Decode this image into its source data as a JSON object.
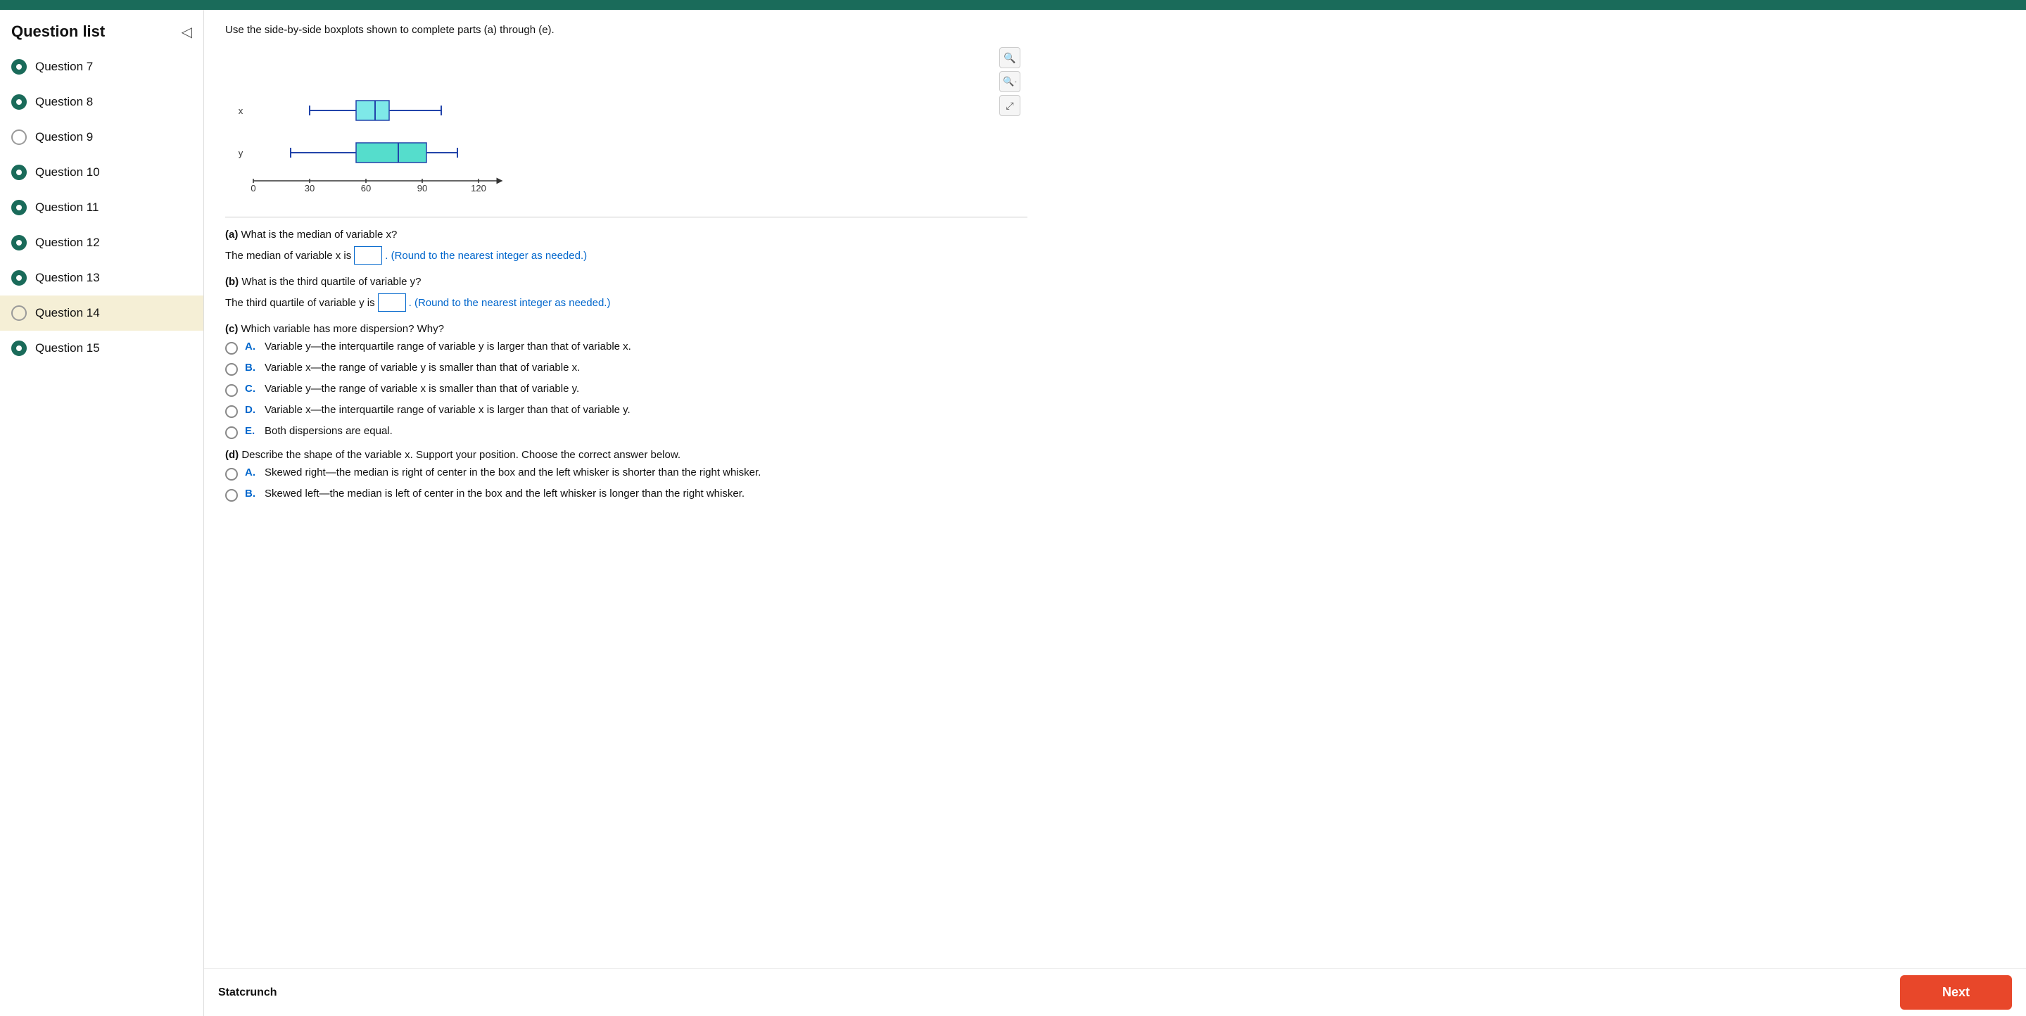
{
  "topBar": {},
  "sidebar": {
    "title": "Question list",
    "collapseLabel": "◁",
    "items": [
      {
        "id": 7,
        "label": "Question 7",
        "filled": true,
        "active": false
      },
      {
        "id": 8,
        "label": "Question 8",
        "filled": true,
        "active": false
      },
      {
        "id": 9,
        "label": "Question 9",
        "filled": false,
        "active": false
      },
      {
        "id": 10,
        "label": "Question 10",
        "filled": true,
        "active": false
      },
      {
        "id": 11,
        "label": "Question 11",
        "filled": true,
        "active": false
      },
      {
        "id": 12,
        "label": "Question 12",
        "filled": true,
        "active": false
      },
      {
        "id": 13,
        "label": "Question 13",
        "filled": true,
        "active": false
      },
      {
        "id": 14,
        "label": "Question 14",
        "filled": false,
        "active": true
      },
      {
        "id": 15,
        "label": "Question 15",
        "filled": true,
        "active": false
      }
    ],
    "footerLabel": "Statcrunch"
  },
  "content": {
    "instruction": "Use the side-by-side boxplots shown to complete parts (a) through (e).",
    "partA": {
      "question": "(a) What is the median of variable x?",
      "answerPrefix": "The median of variable x is",
      "answerSuffix": ". (Round to the nearest integer as needed.)"
    },
    "partB": {
      "question": "(b) What is the third quartile of variable y?",
      "answerPrefix": "The third quartile of variable y is",
      "answerSuffix": ". (Round to the nearest integer as needed.)"
    },
    "partC": {
      "question": "(c) Which variable has more dispersion? Why?",
      "options": [
        {
          "letter": "A.",
          "text": "Variable y—the interquartile range of variable y is larger than that of variable x."
        },
        {
          "letter": "B.",
          "text": "Variable x—the range of variable y is smaller than that of variable x."
        },
        {
          "letter": "C.",
          "text": "Variable y—the range of variable x is smaller than that of variable y."
        },
        {
          "letter": "D.",
          "text": "Variable x—the interquartile range of variable x is larger than that of variable y."
        },
        {
          "letter": "E.",
          "text": "Both dispersions are equal."
        }
      ]
    },
    "partD": {
      "question": "(d) Describe the shape of the variable x. Support your position. Choose the correct answer below.",
      "options": [
        {
          "letter": "A.",
          "text": "Skewed right—the median is right of center in the box and the left whisker is shorter than the right whisker."
        },
        {
          "letter": "B.",
          "text": "Skewed left—the median is left of center in the box and the left whisker is longer than the right whisker."
        }
      ]
    }
  },
  "boxplot": {
    "xLabel": "x",
    "yLabel": "y",
    "axisValues": [
      "0",
      "30",
      "60",
      "90",
      "120"
    ],
    "zoomInLabel": "⊕",
    "zoomOutLabel": "⊖",
    "externalLabel": "⤢"
  },
  "footer": {
    "statcrunchLabel": "Statcrunch",
    "nextLabel": "Next"
  }
}
